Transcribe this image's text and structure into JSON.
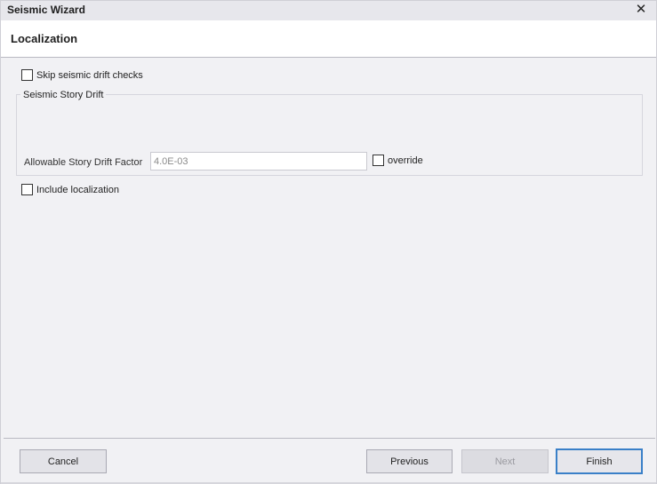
{
  "window": {
    "title": "Seismic Wizard",
    "close_glyph": "✕"
  },
  "header": {
    "title": "Localization"
  },
  "form": {
    "skip_drift": {
      "label": "Skip seismic drift checks",
      "checked": false
    },
    "group": {
      "title": "Seismic Story Drift",
      "factor_label": "Allowable Story Drift Factor",
      "factor_value": "4.0E-03",
      "override_label": "override",
      "override_checked": false
    },
    "include_localization": {
      "label": "Include localization",
      "checked": false
    }
  },
  "footer": {
    "cancel_label": "Cancel",
    "previous_label": "Previous",
    "next_label": "Next",
    "finish_label": "Finish"
  },
  "colors": {
    "accent": "#3a80c8",
    "background": "#f1f1f4"
  }
}
